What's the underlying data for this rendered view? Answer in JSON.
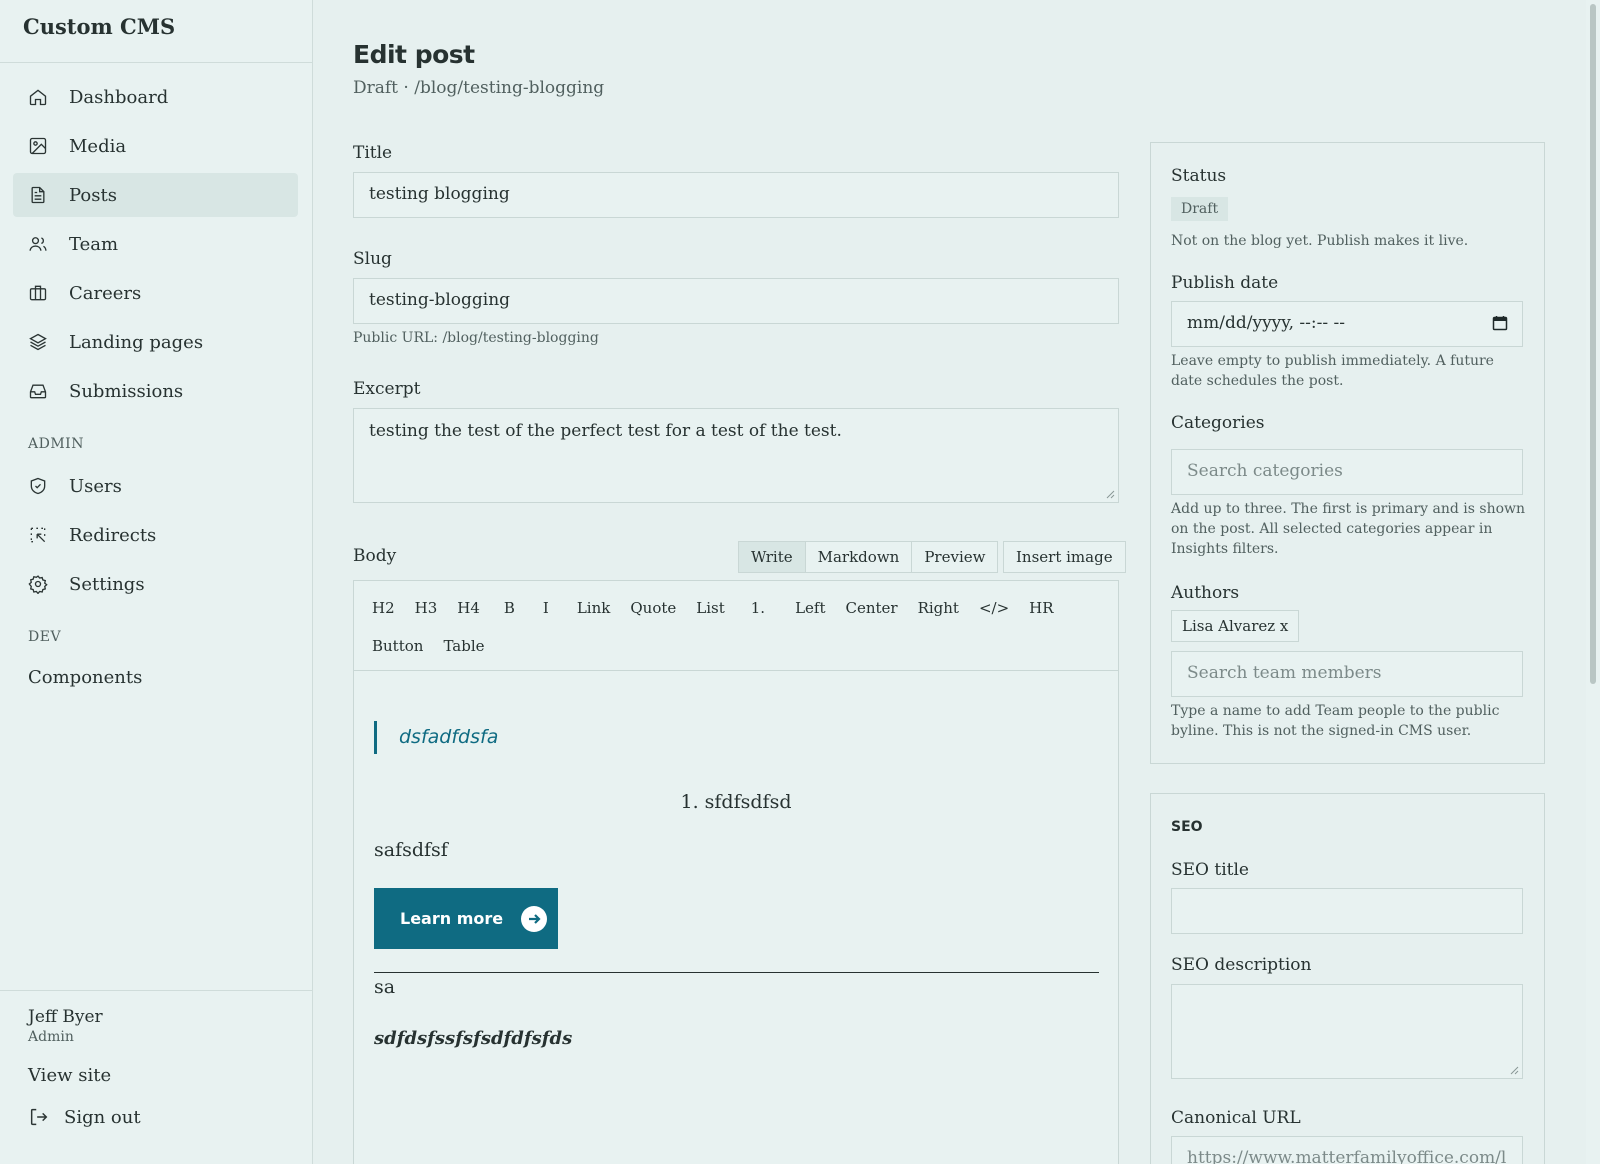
{
  "app": {
    "brand": "Custom CMS"
  },
  "sidebar": {
    "items": [
      {
        "label": "Dashboard",
        "icon": "home-icon"
      },
      {
        "label": "Media",
        "icon": "image-icon"
      },
      {
        "label": "Posts",
        "icon": "document-icon",
        "active": true
      },
      {
        "label": "Team",
        "icon": "users-icon"
      },
      {
        "label": "Careers",
        "icon": "briefcase-icon"
      },
      {
        "label": "Landing pages",
        "icon": "layers-icon"
      },
      {
        "label": "Submissions",
        "icon": "inbox-icon"
      }
    ],
    "admin_heading": "ADMIN",
    "admin_items": [
      {
        "label": "Users",
        "icon": "shield-icon"
      },
      {
        "label": "Redirects",
        "icon": "redirect-icon"
      },
      {
        "label": "Settings",
        "icon": "gear-icon"
      }
    ],
    "dev_heading": "DEV",
    "dev_items": [
      {
        "label": "Components"
      }
    ],
    "user": {
      "name": "Jeff Byer",
      "role": "Admin"
    },
    "view_site": "View site",
    "sign_out": "Sign out"
  },
  "page": {
    "title": "Edit post",
    "subtitle": "Draft · /blog/testing-blogging"
  },
  "form": {
    "title_label": "Title",
    "title_value": "testing blogging",
    "slug_label": "Slug",
    "slug_value": "testing-blogging",
    "slug_hint": "Public URL: /blog/testing-blogging",
    "excerpt_label": "Excerpt",
    "excerpt_value": "testing the test of the perfect test for a test of the test.",
    "body_label": "Body",
    "modes": [
      "Write",
      "Markdown",
      "Preview"
    ],
    "active_mode": "Write",
    "insert_image": "Insert image",
    "toolbar": [
      "H2",
      "H3",
      "H4",
      "B",
      "I",
      "Link",
      "Quote",
      "List",
      "1.",
      "Left",
      "Center",
      "Right",
      "</>",
      "HR",
      "Button",
      "Table"
    ],
    "content": {
      "blockquote": "dsfadfdsfa",
      "ordered_item": "1. sfdfsdfsd",
      "paragraph1": "safsdfsf",
      "button_label": "Learn more",
      "paragraph2": "sa",
      "paragraph3": "sdfdsfssfsfsdfdfsfds"
    }
  },
  "status_panel": {
    "status_label": "Status",
    "status_badge": "Draft",
    "status_hint": "Not on the blog yet. Publish makes it live.",
    "publish_label": "Publish date",
    "publish_value": "mm/dd/yyyy, --:-- --",
    "publish_hint": "Leave empty to publish immediately. A future date schedules the post.",
    "categories_label": "Categories",
    "categories_placeholder": "Search categories",
    "categories_hint": "Add up to three. The first is primary and is shown on the post. All selected categories appear in Insights filters.",
    "authors_label": "Authors",
    "author_chip": "Lisa Alvarez x",
    "authors_placeholder": "Search team members",
    "authors_hint": "Type a name to add Team people to the public byline. This is not the signed-in CMS user."
  },
  "seo_panel": {
    "heading": "SEO",
    "seo_title_label": "SEO title",
    "seo_title_value": "",
    "seo_description_label": "SEO description",
    "seo_description_value": "",
    "canonical_label": "Canonical URL",
    "canonical_placeholder": "https://www.matterfamilyoffice.com/l"
  },
  "colors": {
    "accent": "#0f6b82",
    "background": "#e6f0ef",
    "sidebar": "#e8f2f1",
    "active_nav": "#d8e6e4",
    "border": "#c9d7d5"
  }
}
